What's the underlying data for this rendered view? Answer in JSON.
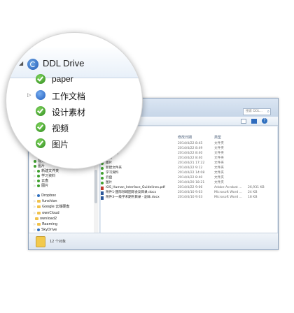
{
  "lens": {
    "title": "DDL Drive",
    "items": [
      {
        "label": "paper",
        "icon": "sync-check-icon"
      },
      {
        "label": "工作文档",
        "icon": "sync-blue-icon"
      },
      {
        "label": "设计素材",
        "icon": "sync-check-icon"
      },
      {
        "label": "视频",
        "icon": "sync-check-icon"
      },
      {
        "label": "图片",
        "icon": "sync-check-icon"
      }
    ]
  },
  "window": {
    "search_placeholder": "搜索 DDL...",
    "columns": {
      "date": "修改日期",
      "type": "类型"
    },
    "nav": [
      {
        "label": "视频",
        "arrow": ""
      },
      {
        "label": "图片",
        "arrow": ""
      },
      {
        "label": "新建文件夹",
        "arrow": "▷"
      },
      {
        "label": "学习资料",
        "arrow": "▷"
      },
      {
        "label": "云盘",
        "arrow": "▷"
      },
      {
        "label": "图片",
        "arrow": "▷"
      },
      {
        "label": "Dropbox",
        "arrow": "▷"
      },
      {
        "label": "funshion",
        "arrow": "▷"
      },
      {
        "label": "Google 云端硬盘",
        "arrow": "▷"
      },
      {
        "label": "ownCloud",
        "arrow": "▷"
      },
      {
        "label": "ownload2",
        "arrow": ""
      },
      {
        "label": "Roaming",
        "arrow": "▷"
      },
      {
        "label": "SkyDrive",
        "arrow": "▷"
      }
    ],
    "files": [
      {
        "name": "paper",
        "date": "2014/4/22 8:45",
        "type": "文件夹",
        "size": "",
        "icon": "folder"
      },
      {
        "name": "工作文档",
        "date": "2014/4/22 8:49",
        "type": "文件夹",
        "size": "",
        "icon": "folder"
      },
      {
        "name": "设计素材",
        "date": "2014/4/22 8:40",
        "type": "文件夹",
        "size": "",
        "icon": "folder"
      },
      {
        "name": "视频",
        "date": "2014/4/22 8:40",
        "type": "文件夹",
        "size": "",
        "icon": "folder"
      },
      {
        "name": "图片",
        "date": "2014/4/21 17:22",
        "type": "文件夹",
        "size": "",
        "icon": "folder"
      },
      {
        "name": "新建文件夹",
        "date": "2014/4/22 9:12",
        "type": "文件夹",
        "size": "",
        "icon": "folder"
      },
      {
        "name": "学习资料",
        "date": "2014/4/22 14:08",
        "type": "文件夹",
        "size": "",
        "icon": "folder"
      },
      {
        "name": "云盘",
        "date": "2014/4/22 8:40",
        "type": "文件夹",
        "size": "",
        "icon": "folder"
      },
      {
        "name": "图片",
        "date": "2014/4/20 18:21",
        "type": "文件夹",
        "size": "",
        "icon": "folder"
      },
      {
        "name": "iOS_Human_Interface_Guidelines.pdf",
        "date": "2014/4/22 9:06",
        "type": "Adobe Acrobat ...",
        "size": "26,931 KB",
        "icon": "pdf"
      },
      {
        "name": "附件1-国际领域国际会议目录.docx",
        "date": "2014/4/10 9:03",
        "type": "Microsoft Word ...",
        "size": "24 KB",
        "icon": "doc"
      },
      {
        "name": "附件3-一级学术期刊目录 - 副本.docx",
        "date": "2014/4/10 9:03",
        "type": "Microsoft Word ...",
        "size": "18 KB",
        "icon": "doc"
      }
    ],
    "status": "12 个对象"
  }
}
